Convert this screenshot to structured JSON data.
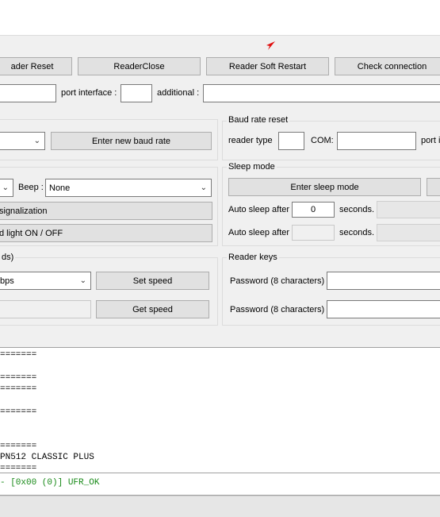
{
  "toolbar": {
    "reader_reset": "ader Reset",
    "reader_close": "ReaderClose",
    "reader_soft_restart": "Reader Soft Restart",
    "check_connection": "Check connection"
  },
  "port_row": {
    "port_interface_label": "port interface :",
    "additional_label": "additional :",
    "port_value": "",
    "port_interface_value": "",
    "additional_value": ""
  },
  "baud_rate": {
    "enter_new_baud_rate": "Enter new baud rate",
    "selected": ""
  },
  "baud_rate_reset": {
    "title": "Baud rate reset",
    "reader_type_label": "reader type",
    "com_label": "COM:",
    "port_label_partial": "port i"
  },
  "signalization": {
    "beep_label": "Beep :",
    "beep_value": "None",
    "signalization_button": "signalization",
    "light_button": "d light ON / OFF"
  },
  "sleep_mode": {
    "title": "Sleep mode",
    "enter_sleep_mode": "Enter sleep mode",
    "auto_sleep_label_1": "Auto sleep after",
    "auto_sleep_value_1": "0",
    "seconds_label_1": "seconds.",
    "auto_sleep_label_2": "Auto sleep after",
    "auto_sleep_value_2": "",
    "seconds_label_2": "seconds."
  },
  "speed": {
    "title_partial": "ds)",
    "speed_value": "bps",
    "set_speed": "Set speed",
    "get_speed": "Get speed",
    "get_value": ""
  },
  "reader_keys": {
    "title": "Reader keys",
    "password_label_1": "Password (8 characters) :",
    "password_label_2": "Password (8 characters) :"
  },
  "log": {
    "lines": [
      "=======",
      "=======",
      "=======",
      "=======",
      "=======",
      "PN512 CLASSIC PLUS",
      "======="
    ],
    "status_line": "- [0x00 (0)] UFR_OK"
  },
  "colors": {
    "status_ok": "#188a18",
    "cursor_arrow": "#e01010"
  }
}
